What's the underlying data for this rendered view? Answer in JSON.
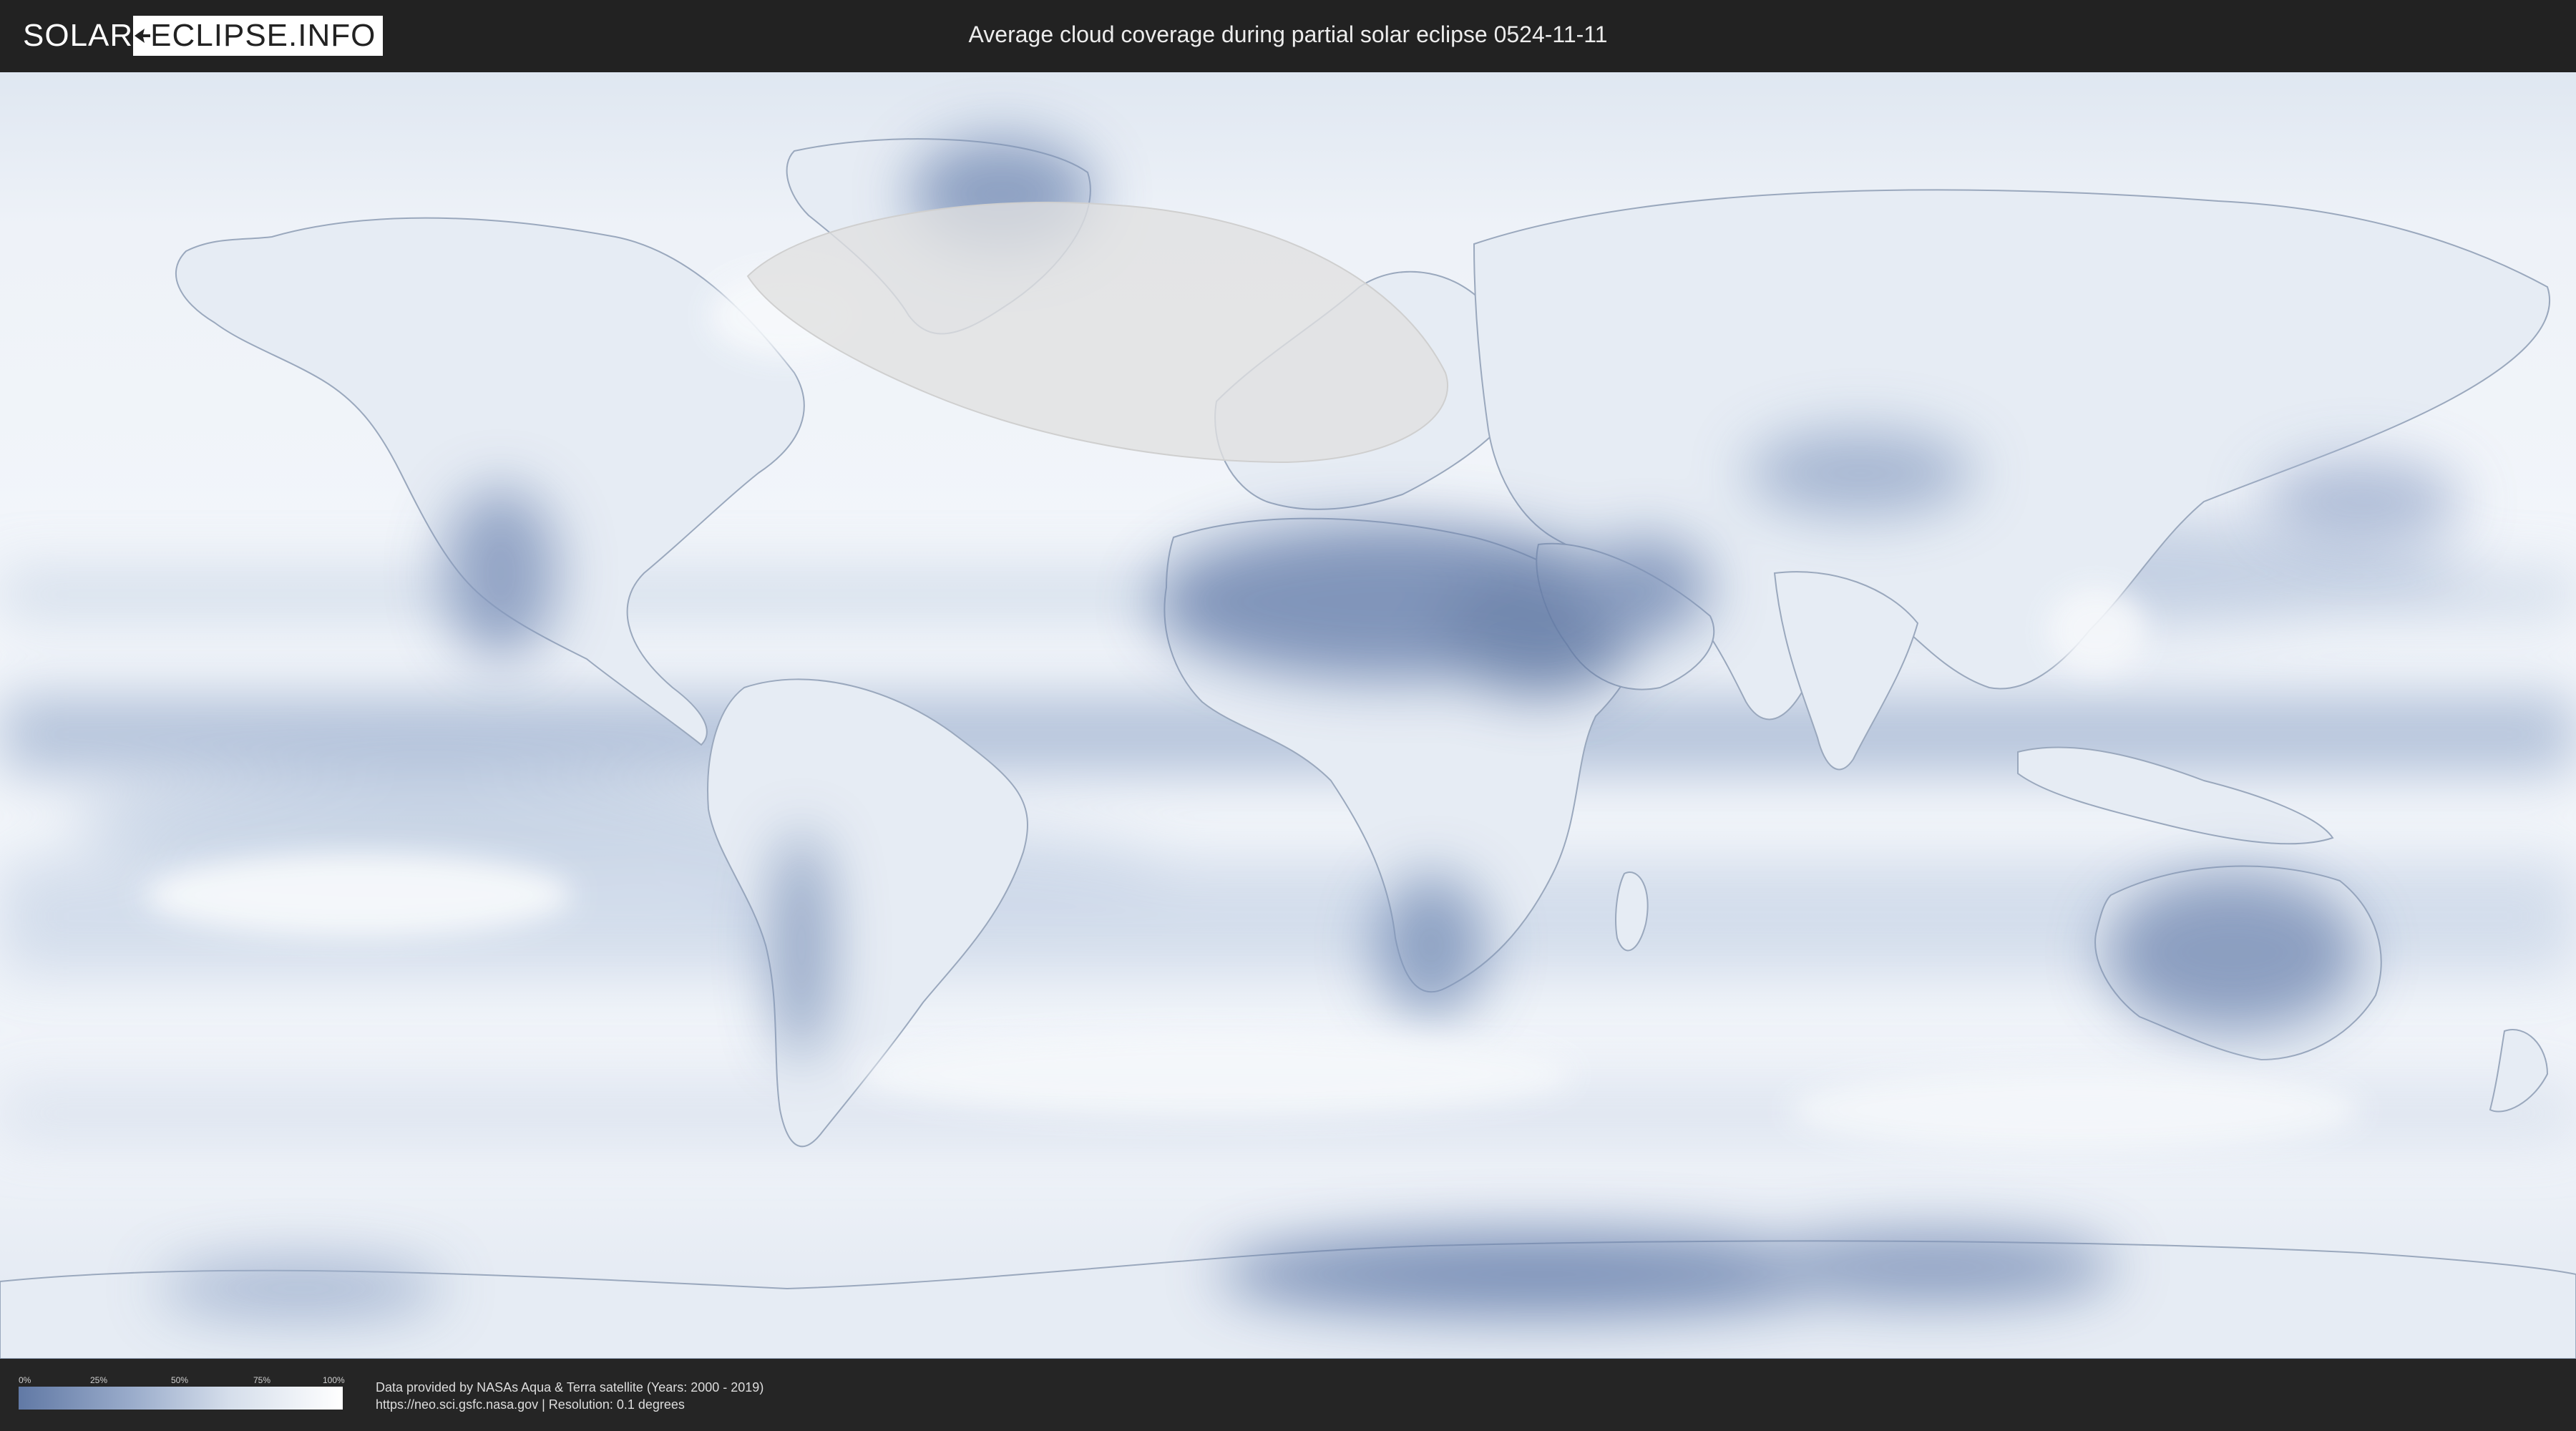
{
  "header": {
    "logo_left": "SOLAR",
    "logo_right": "ECLIPSE.INFO",
    "title": "Average cloud coverage during partial solar eclipse 0524-11-11"
  },
  "legend": {
    "ticks": [
      "0%",
      "25%",
      "50%",
      "75%",
      "100%"
    ],
    "colors": {
      "low": "#6179a5",
      "high": "#ffffff"
    }
  },
  "credits": {
    "line1": "Data provided by NASAs Aqua & Terra satellite (Years: 2000 - 2019)",
    "line2": "https://neo.sci.gsfc.nasa.gov | Resolution: 0.1 degrees"
  },
  "map": {
    "projection": "equirectangular",
    "eclipse_region_color": "#e0e0e0",
    "cloud_low_color": "#6a82ae",
    "cloud_high_color": "#ffffff"
  }
}
